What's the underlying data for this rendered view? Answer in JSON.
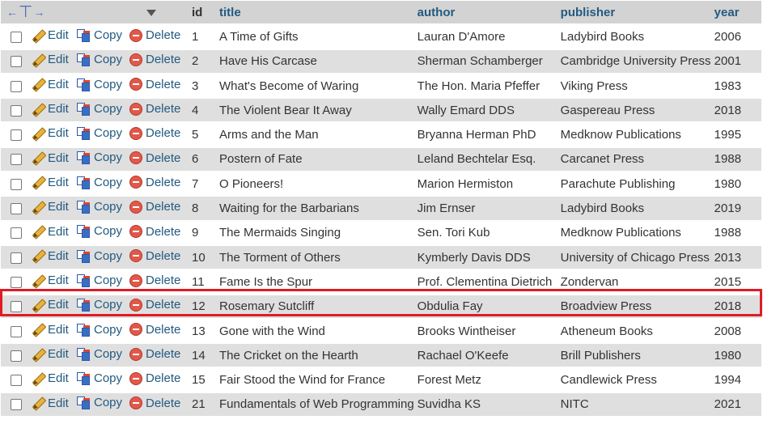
{
  "header": {
    "columns": [
      "id",
      "title",
      "author",
      "publisher",
      "year"
    ]
  },
  "actions": {
    "edit": "Edit",
    "copy": "Copy",
    "delete": "Delete"
  },
  "colors": {
    "link": "#235a81",
    "row_odd": "#ffffff",
    "row_even": "#dfdfdf",
    "header_bg": "#d3d3d3",
    "highlight_border": "#e01b24"
  },
  "icons": {
    "edit": "pencil-icon",
    "copy": "copy-icon",
    "delete": "delete-icon",
    "sort": "sort-arrow-icon",
    "columns": "column-arrows-icon"
  },
  "rows": [
    {
      "id": "1",
      "title": "A Time of Gifts",
      "author": "Lauran D'Amore",
      "publisher": "Ladybird Books",
      "year": "2006"
    },
    {
      "id": "2",
      "title": "Have His Carcase",
      "author": "Sherman Schamberger",
      "publisher": "Cambridge University Press",
      "year": "2001"
    },
    {
      "id": "3",
      "title": "What's Become of Waring",
      "author": "The Hon. Maria Pfeffer",
      "publisher": "Viking Press",
      "year": "1983"
    },
    {
      "id": "4",
      "title": "The Violent Bear It Away",
      "author": "Wally Emard DDS",
      "publisher": "Gaspereau Press",
      "year": "2018"
    },
    {
      "id": "5",
      "title": "Arms and the Man",
      "author": "Bryanna Herman PhD",
      "publisher": "Medknow Publications",
      "year": "1995"
    },
    {
      "id": "6",
      "title": "Postern of Fate",
      "author": "Leland Bechtelar Esq.",
      "publisher": "Carcanet Press",
      "year": "1988"
    },
    {
      "id": "7",
      "title": "O Pioneers!",
      "author": "Marion Hermiston",
      "publisher": "Parachute Publishing",
      "year": "1980"
    },
    {
      "id": "8",
      "title": "Waiting for the Barbarians",
      "author": "Jim Ernser",
      "publisher": "Ladybird Books",
      "year": "2019"
    },
    {
      "id": "9",
      "title": "The Mermaids Singing",
      "author": "Sen. Tori Kub",
      "publisher": "Medknow Publications",
      "year": "1988"
    },
    {
      "id": "10",
      "title": "The Torment of Others",
      "author": "Kymberly Davis DDS",
      "publisher": "University of Chicago Press",
      "year": "2013"
    },
    {
      "id": "11",
      "title": "Fame Is the Spur",
      "author": "Prof. Clementina Dietrich",
      "publisher": "Zondervan",
      "year": "2015"
    },
    {
      "id": "12",
      "title": "Rosemary Sutcliff",
      "author": "Obdulia Fay",
      "publisher": "Broadview Press",
      "year": "2018"
    },
    {
      "id": "13",
      "title": "Gone with the Wind",
      "author": "Brooks Wintheiser",
      "publisher": "Atheneum Books",
      "year": "2008"
    },
    {
      "id": "14",
      "title": "The Cricket on the Hearth",
      "author": "Rachael O'Keefe",
      "publisher": "Brill Publishers",
      "year": "1980"
    },
    {
      "id": "15",
      "title": "Fair Stood the Wind for France",
      "author": "Forest Metz",
      "publisher": "Candlewick Press",
      "year": "1994"
    },
    {
      "id": "21",
      "title": "Fundamentals of Web Programming",
      "author": "Suvidha KS",
      "publisher": "NITC",
      "year": "2021"
    }
  ]
}
